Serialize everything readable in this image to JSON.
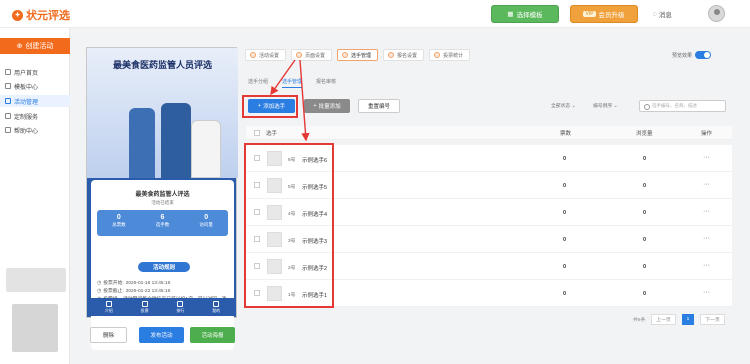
{
  "header": {
    "logo_text": "状元评选",
    "template_button": "选择模板",
    "upgrade_button": "会员升级",
    "vip_badge": "VIP",
    "message_label": "消息"
  },
  "sidebar": {
    "create_button": "创建活动",
    "items": [
      {
        "label": "用户首页",
        "active": false
      },
      {
        "label": "模板中心",
        "active": false
      },
      {
        "label": "活动管理",
        "active": true
      },
      {
        "label": "定制服务",
        "active": false
      },
      {
        "label": "帮助中心",
        "active": false
      }
    ]
  },
  "preview": {
    "banner_title": "最美食医药监管人员评选",
    "card_title": "最美食药监管人评选",
    "card_subtitle": "活动已结束",
    "stats": [
      {
        "value": "0",
        "label": "总票数"
      },
      {
        "value": "6",
        "label": "选手数"
      },
      {
        "value": "0",
        "label": "访问量"
      }
    ],
    "rules_button": "活动规则",
    "info": [
      {
        "label": "投票开始:",
        "value": "2025-01-16 13:45:16"
      },
      {
        "label": "投票截止:",
        "value": "2025-01-22 13:45:16"
      },
      {
        "label": "投票规则:",
        "value": "活动期间每个微信号只可以投1次，可以对同一选手投1票"
      }
    ],
    "tabs": [
      "介绍",
      "投票",
      "排行",
      "我的"
    ]
  },
  "actions": {
    "delete": "删除",
    "publish": "发布活动",
    "poster": "活动海报"
  },
  "steps": [
    {
      "label": "活动设置",
      "active": false
    },
    {
      "label": "页面设置",
      "active": false
    },
    {
      "label": "选手管理",
      "active": true
    },
    {
      "label": "报名设置",
      "active": false
    },
    {
      "label": "投票统计",
      "active": false
    }
  ],
  "preview_toggle_label": "预览效果",
  "subtabs": [
    {
      "label": "选手分组",
      "active": false
    },
    {
      "label": "选手管理",
      "active": true
    },
    {
      "label": "报名审核",
      "active": false
    }
  ],
  "toolbar": {
    "add_button": "添加选手",
    "batch_button": "批量添加",
    "reset_button": "重置编号",
    "filter_status": "全部状态",
    "filter_sort": "编号倒序",
    "search_placeholder": "选手编号、名称、描述"
  },
  "table": {
    "headers": [
      "选手",
      "票数",
      "浏览量",
      "操作"
    ],
    "rows": [
      {
        "no": "6号",
        "name": "示例选手6",
        "votes": "0",
        "views": "0",
        "ops": "···"
      },
      {
        "no": "5号",
        "name": "示例选手5",
        "votes": "0",
        "views": "0",
        "ops": "···"
      },
      {
        "no": "4号",
        "name": "示例选手4",
        "votes": "0",
        "views": "0",
        "ops": "···"
      },
      {
        "no": "3号",
        "name": "示例选手3",
        "votes": "0",
        "views": "0",
        "ops": "···"
      },
      {
        "no": "2号",
        "name": "示例选手2",
        "votes": "0",
        "views": "0",
        "ops": "···"
      },
      {
        "no": "1号",
        "name": "示例选手1",
        "votes": "0",
        "views": "0",
        "ops": "···"
      }
    ]
  },
  "pagination": {
    "total": "共6条",
    "prev": "上一页",
    "current": "1",
    "next": "下一页"
  },
  "colors": {
    "brand": "#f26b1d",
    "primary": "#2a7de1",
    "highlight": "#e53935"
  }
}
